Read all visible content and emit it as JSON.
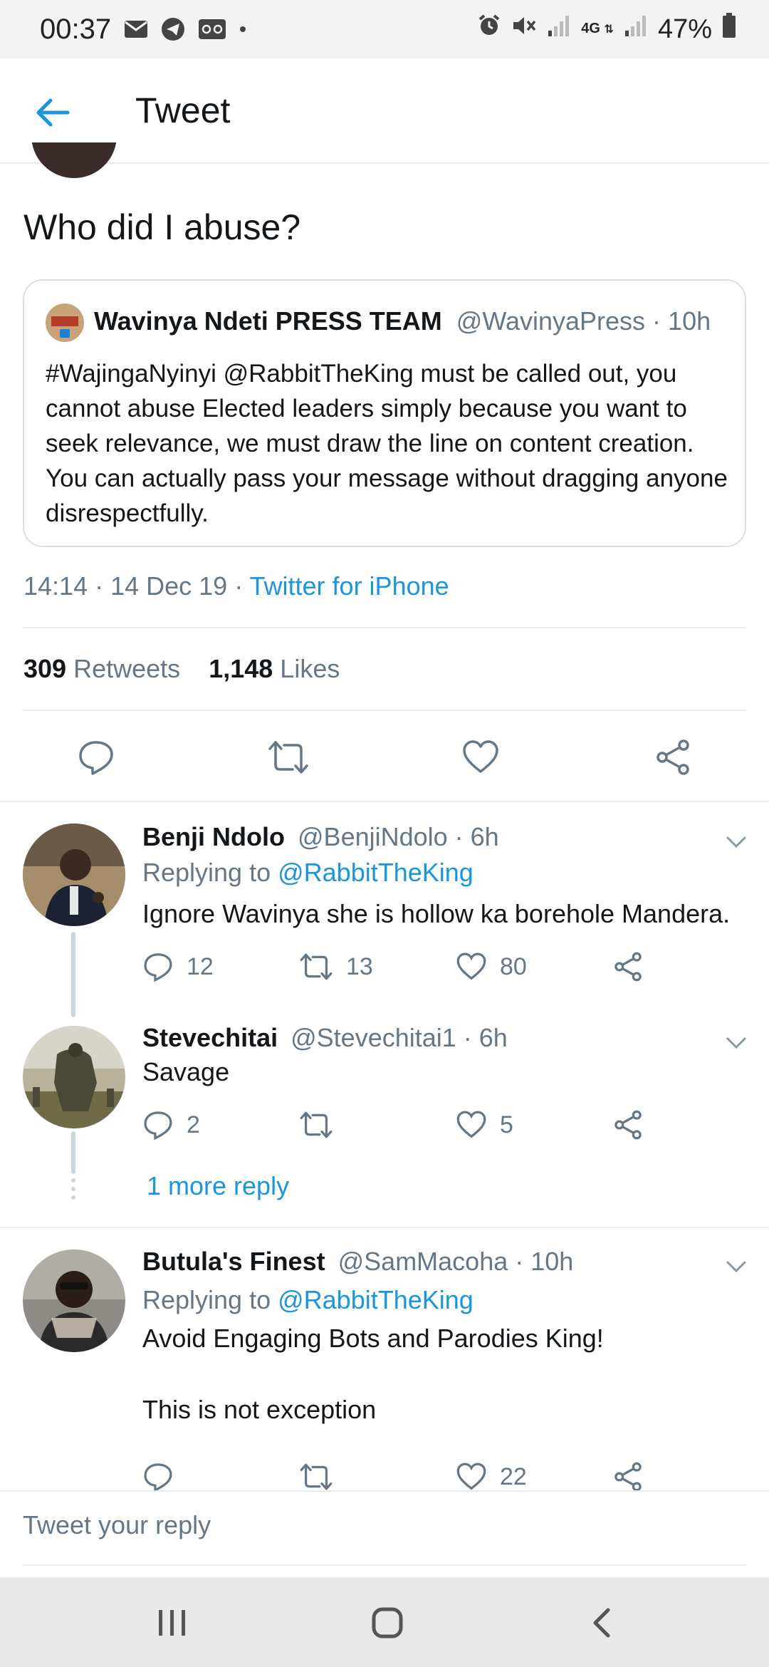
{
  "status_bar": {
    "time": "00:37",
    "battery": "47%",
    "network": "4G"
  },
  "header": {
    "title": "Tweet"
  },
  "main_tweet": {
    "text": "Who did I abuse?",
    "timestamp": "14:14 · 14 Dec 19 · ",
    "source": "Twitter for iPhone",
    "retweets_count": "309",
    "retweets_label": "Retweets",
    "likes_count": "1,148",
    "likes_label": "Likes"
  },
  "quoted_tweet": {
    "name": "Wavinya Ndeti PRESS TEAM",
    "handle_time": "@WavinyaPress · 10h",
    "text": "#WajingaNyinyi @RabbitTheKing must be called out, you cannot abuse Elected leaders simply because you want to seek relevance, we must draw the line on content creation. You can actually pass your message without dragging anyone disrespectfully."
  },
  "replies": [
    {
      "name": "Benji Ndolo",
      "handle_time": "@BenjiNdolo · 6h",
      "replying_prefix": "Replying to ",
      "replying_handle": "@RabbitTheKing",
      "text": "Ignore Wavinya she is hollow ka borehole Mandera.",
      "reply_count": "12",
      "retweet_count": "13",
      "like_count": "80"
    },
    {
      "name": "Stevechitai",
      "handle_time": "@Stevechitai1 · 6h",
      "text": "Savage",
      "reply_count": "2",
      "retweet_count": "",
      "like_count": "5",
      "more_replies": "1 more reply"
    },
    {
      "name": "Butula's Finest",
      "handle_time": "@SamMacoha · 10h",
      "replying_prefix": "Replying to ",
      "replying_handle": "@RabbitTheKing",
      "text": "Avoid Engaging Bots and Parodies King!\n\nThis is not exception",
      "reply_count": "",
      "retweet_count": "",
      "like_count": "22"
    }
  ],
  "reply_box": {
    "placeholder": "Tweet your reply"
  },
  "colors": {
    "accent": "#1b95e0",
    "text": "#14171a",
    "muted": "#657786",
    "divider": "#e6ecf0"
  },
  "icons": [
    "back-arrow-icon",
    "reply-icon",
    "retweet-icon",
    "like-icon",
    "share-icon",
    "chevron-down-icon",
    "nav-recents-icon",
    "nav-home-icon",
    "nav-back-icon"
  ]
}
